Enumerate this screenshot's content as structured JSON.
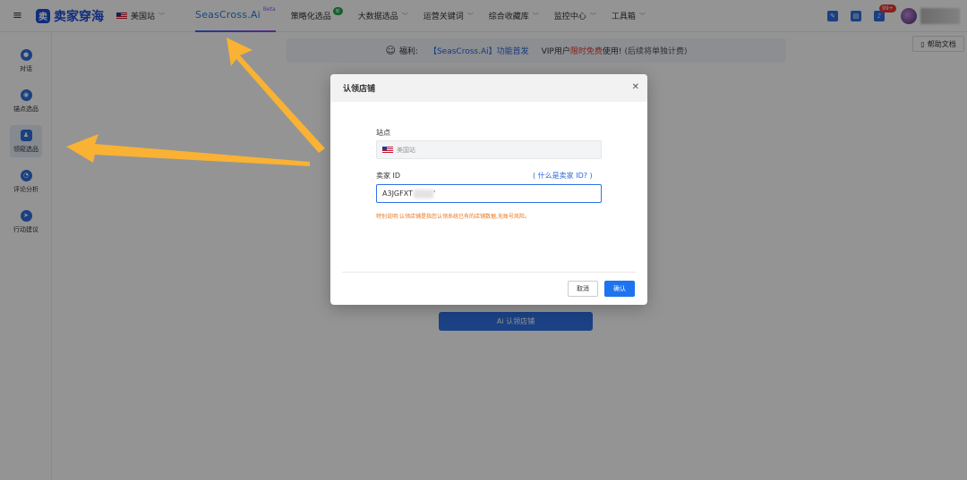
{
  "topbar": {
    "menu_icon": "hamburger-icon",
    "logo_mark": "卖",
    "logo_text": "卖家穿海",
    "site": "美国站",
    "nav": [
      {
        "label": "SeasCross.Ai",
        "sup": "Beta",
        "active": true
      },
      {
        "label": "策略化选品",
        "badge": "新"
      },
      {
        "label": "大数据选品"
      },
      {
        "label": "运营关键词"
      },
      {
        "label": "综合收藏库"
      },
      {
        "label": "监控中心"
      },
      {
        "label": "工具箱"
      }
    ],
    "notification_count": "99+"
  },
  "sidebar": {
    "items": [
      {
        "label": "对话",
        "icon": "chat-icon",
        "color": "#2f6fe0"
      },
      {
        "label": "锚点选品",
        "icon": "globe-icon",
        "color": "#2f6fe0"
      },
      {
        "label": "领窥选品",
        "icon": "user-icon",
        "color": "#2f6fe0",
        "active": true
      },
      {
        "label": "评论分析",
        "icon": "chart-icon",
        "color": "#2f6fe0"
      },
      {
        "label": "行动建议",
        "icon": "compass-icon",
        "color": "#2f6fe0"
      }
    ]
  },
  "banner": {
    "prefix": "福利:",
    "product": "【SeasCross.Ai】功能首发",
    "vip": "VIP用户",
    "free": "限时免费",
    "use": "使用!",
    "note": "(后续将单独计费)"
  },
  "help_doc": "帮助文档",
  "bg_claim_button": "Ai 认领店铺",
  "modal": {
    "title": "认领店铺",
    "site_label": "站点",
    "site_value": "美国站",
    "seller_label": "卖家 ID",
    "what_link": "( 什么是卖家 ID? )",
    "seller_value": "A3JGFXT",
    "seller_suffix": "'",
    "note": "特别说明:认领店铺是指您认领系统已有的店铺数据,无账号风险。",
    "cancel": "取消",
    "confirm": "确认"
  },
  "colors": {
    "primary": "#1e73ef",
    "arrow": "#f9b233",
    "note": "#e8741a"
  }
}
